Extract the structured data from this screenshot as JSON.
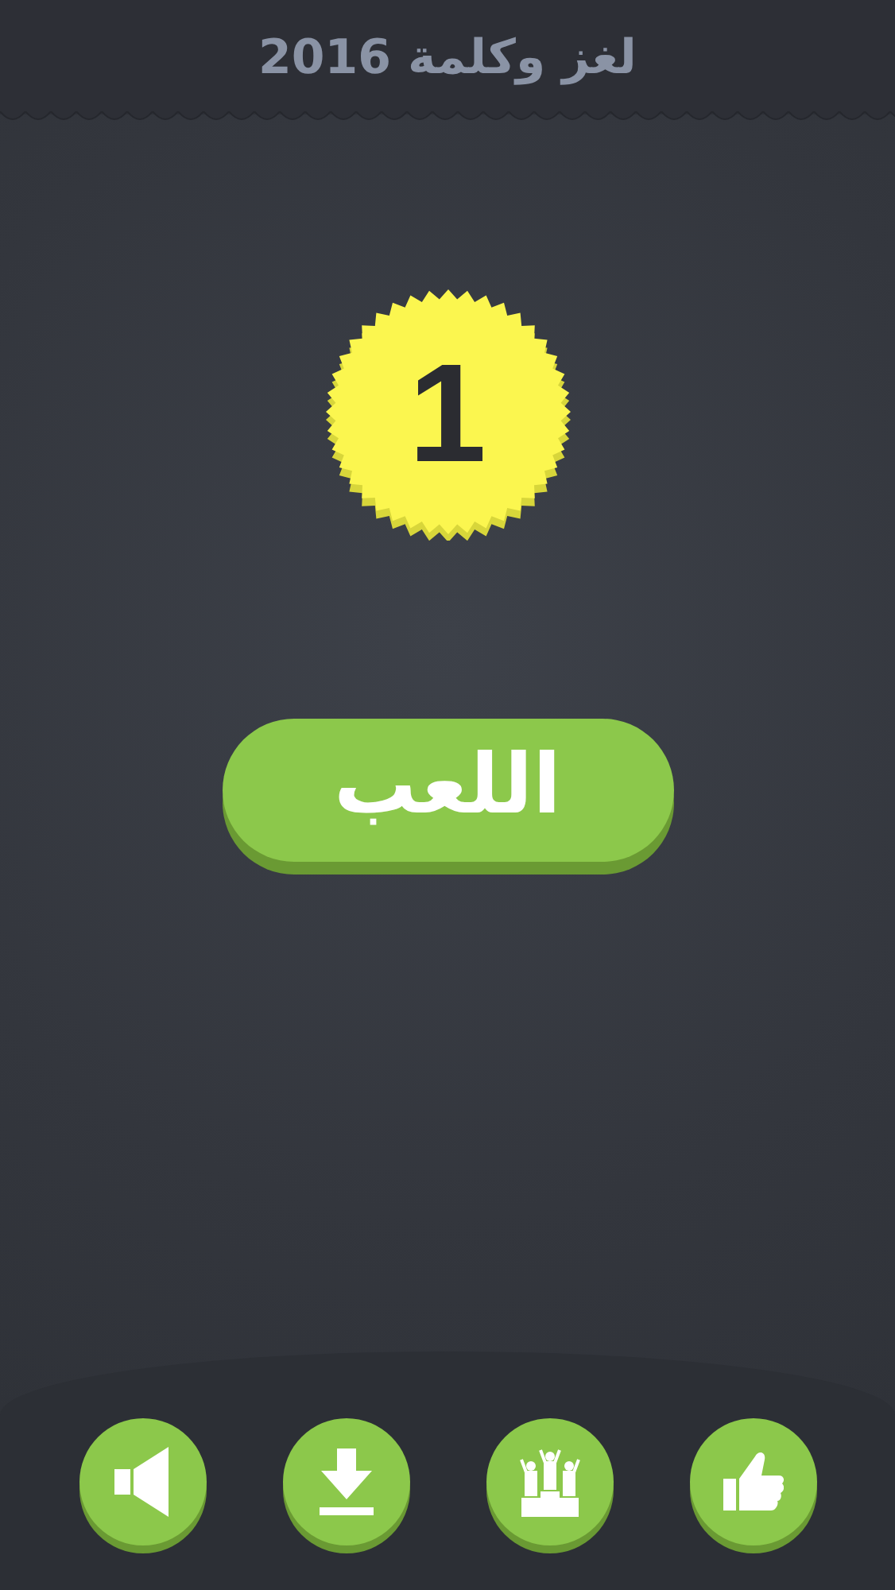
{
  "header": {
    "title": "لغز وكلمة 2016"
  },
  "level_badge": {
    "number": "1"
  },
  "play_button": {
    "label": "اللعب"
  },
  "bottom_buttons": [
    {
      "kind": "sound"
    },
    {
      "kind": "download"
    },
    {
      "kind": "podium"
    },
    {
      "kind": "like"
    }
  ]
}
